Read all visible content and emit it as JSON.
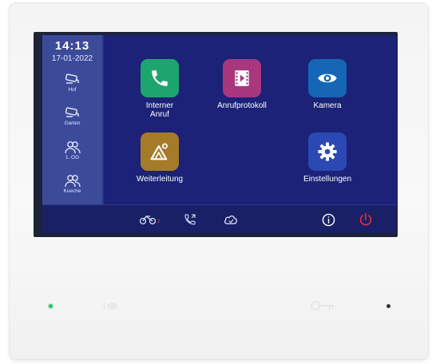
{
  "status": {
    "time": "14:13",
    "date": "17-01-2022"
  },
  "cameras": [
    {
      "label": "Hof",
      "icon": "camera-icon"
    },
    {
      "label": "Garten",
      "icon": "camera-icon"
    },
    {
      "label": "1. OG",
      "icon": "people-icon"
    },
    {
      "label": "Kueche",
      "icon": "people-icon"
    }
  ],
  "apps": [
    {
      "label": "Interner Anruf",
      "icon": "phone-icon",
      "color": "#1ea56e"
    },
    {
      "label": "Anrufprotokoll",
      "icon": "film-icon",
      "color": "#a8377e"
    },
    {
      "label": "Kamera",
      "icon": "eye-icon",
      "color": "#1567b6"
    },
    {
      "label": "Weiterleitung",
      "icon": "mountain-icon",
      "color": "#a57b2a"
    },
    {
      "label": "Einstellungen",
      "icon": "gear-icon",
      "color": "#2c48b5"
    }
  ],
  "bottom_bar": {
    "icons": [
      "do-not-disturb-icon",
      "call-forward-icon",
      "cloud-icon",
      "info-icon",
      "power-icon"
    ],
    "colors": {
      "info": "#ffffff",
      "power": "#e4303c",
      "dnd_mark": "#e4303c"
    }
  },
  "hardware": {
    "buttons": [
      "talk-button-icon",
      "key-icon"
    ],
    "led_color": "#2ec36a"
  }
}
